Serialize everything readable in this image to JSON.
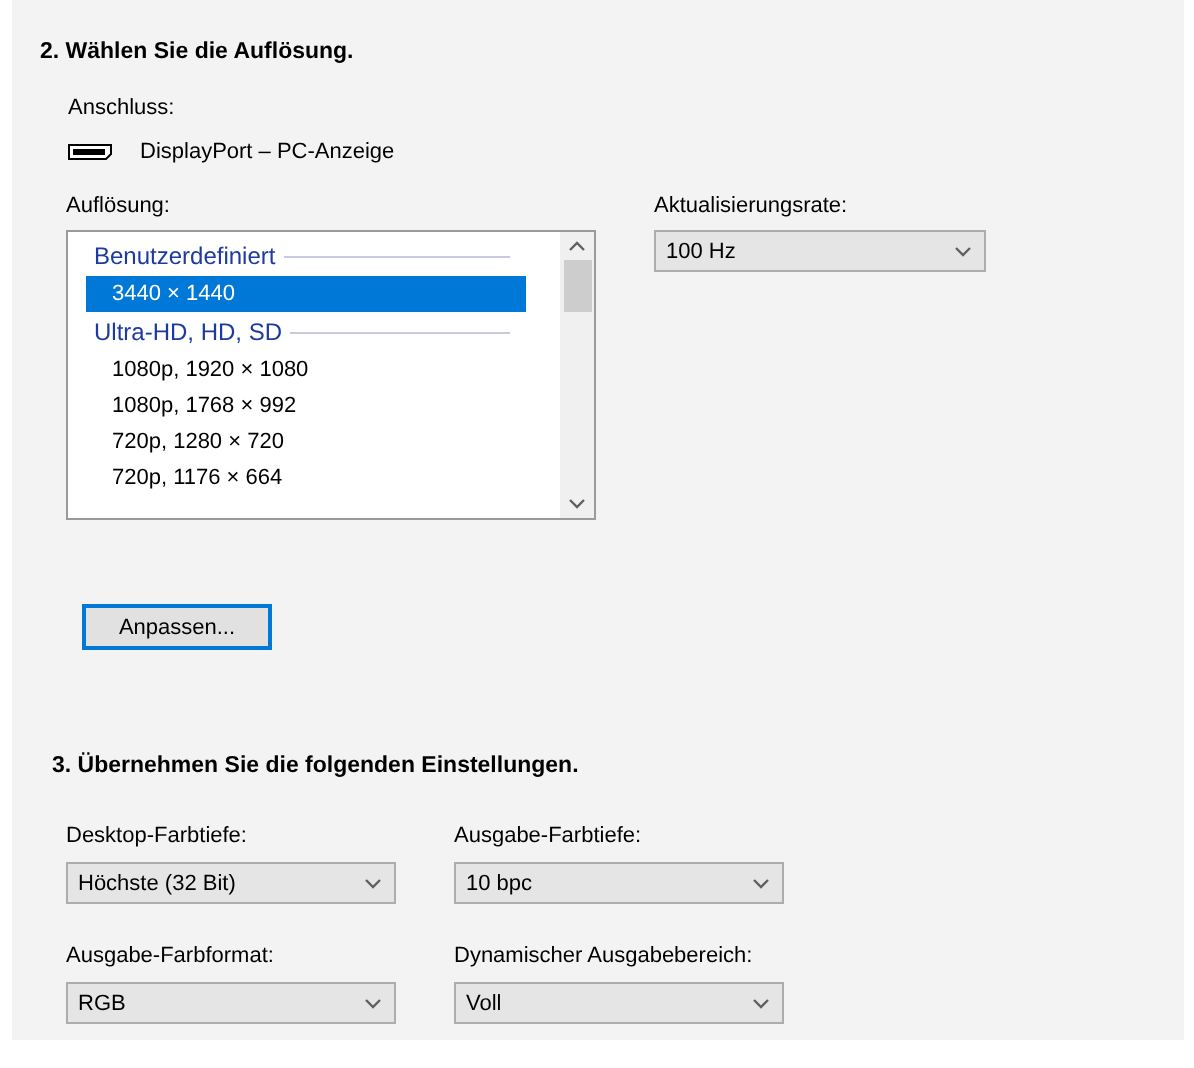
{
  "section_2": {
    "title": "2. Wählen Sie die Auflösung.",
    "connection_label": "Anschluss:",
    "connection": "DisplayPort – PC-Anzeige",
    "resolution_label": "Auflösung:",
    "resolution_list": [
      {
        "kind": "group",
        "label": "Benutzerdefiniert"
      },
      {
        "kind": "item",
        "label": "3440 × 1440",
        "selected": true
      },
      {
        "kind": "group",
        "label": "Ultra-HD, HD, SD"
      },
      {
        "kind": "item",
        "label": "1080p, 1920 × 1080",
        "selected": false
      },
      {
        "kind": "item",
        "label": "1080p, 1768 × 992",
        "selected": false
      },
      {
        "kind": "item",
        "label": "720p, 1280 × 720",
        "selected": false
      },
      {
        "kind": "item",
        "label": "720p, 1176 × 664",
        "selected": false
      }
    ],
    "refresh_label": "Aktualisierungsrate:",
    "refresh_rate": "100 Hz",
    "customize_button": "Anpassen..."
  },
  "section_3": {
    "title": "3. Übernehmen Sie die folgenden Einstellungen.",
    "settings": [
      {
        "label": "Desktop-Farbtiefe:",
        "value": "Höchste (32 Bit)"
      },
      {
        "label": "Ausgabe-Farbtiefe:",
        "value": "10 bpc"
      },
      {
        "label": "Ausgabe-Farbformat:",
        "value": "RGB"
      },
      {
        "label": "Dynamischer Ausgabebereich:",
        "value": "Voll"
      }
    ]
  }
}
